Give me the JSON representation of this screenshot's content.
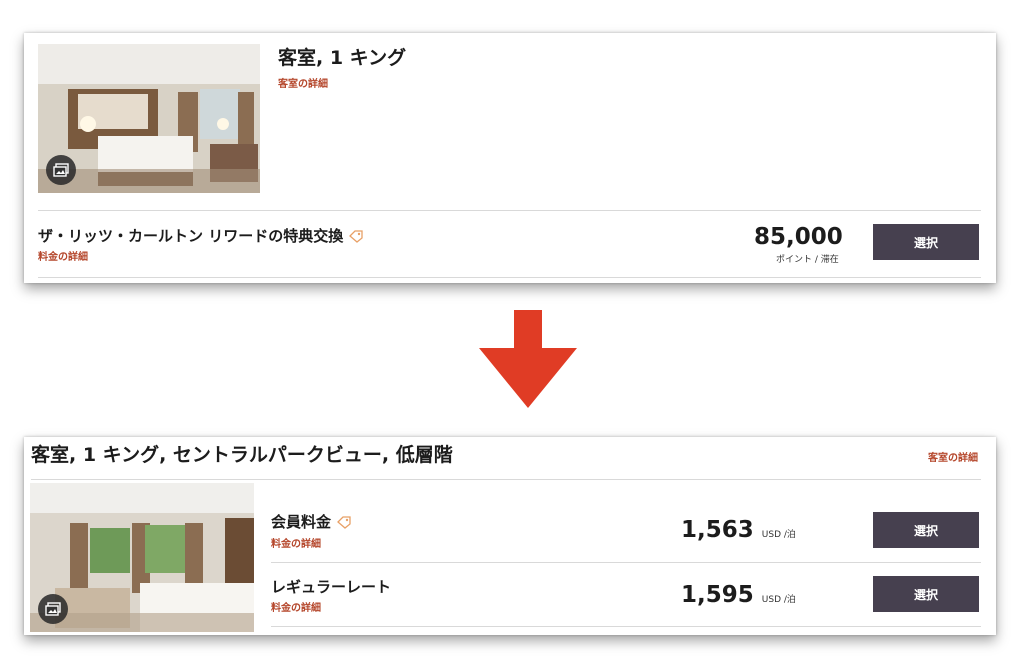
{
  "before": {
    "room_title": "客室, 1 キング",
    "room_details_link": "客室の詳細",
    "rate": {
      "name": "ザ・リッツ・カールトン リワードの特典交換",
      "details_link": "料金の詳細",
      "price": "85,000",
      "unit": "ポイント / 滞在",
      "select_label": "選択"
    }
  },
  "after": {
    "room_title": "客室, 1 キング, セントラルパークビュー, 低層階",
    "room_details_link": "客室の詳細",
    "rates": [
      {
        "name": "会員料金",
        "details_link": "料金の詳細",
        "price": "1,563",
        "unit": "USD /泊",
        "select_label": "選択"
      },
      {
        "name": "レギュラーレート",
        "details_link": "料金の詳細",
        "price": "1,595",
        "unit": "USD /泊",
        "select_label": "選択"
      }
    ]
  },
  "icons": {
    "gallery": "gallery-icon",
    "member_tag": "tag-icon",
    "arrow": "arrow-down-icon"
  },
  "colors": {
    "accent_link": "#b5472c",
    "button_bg": "#46404f",
    "arrow": "#e03c25"
  }
}
